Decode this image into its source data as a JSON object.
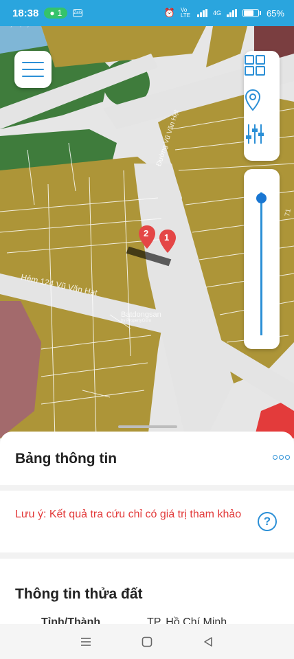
{
  "status_bar": {
    "time": "18:38",
    "hotspot_count": "1",
    "zalo_label": "Zalo",
    "volte_label": "Vo LTE",
    "network_label": "4G",
    "battery": "65%"
  },
  "map": {
    "watermark_brand": "Batdongsan",
    "watermark_sub": "by PropertyGuru",
    "street_1": "Đường Vũ Văn Hạt",
    "street_2": "Hẻm 124 Vũ Văn Hạt",
    "marker_1": "1",
    "marker_2": "2",
    "edge_label": "71",
    "zoom_level": 0.04
  },
  "sheet": {
    "title": "Bảng thông tin",
    "notice": "Lưu ý: Kết quả tra cứu chỉ có giá trị tham khảo",
    "help_symbol": "?",
    "parcel_title": "Thông tin thửa đất",
    "province_label": "Tỉnh/Thành",
    "province_value": "TP. Hồ Chí Minh"
  },
  "colors": {
    "status_bar": "#2aa5de",
    "accent": "#2b8fd6",
    "land_residential": "#ad9538",
    "land_green": "#3e7a3a",
    "notice_text": "#e23a3a"
  },
  "icons": [
    "menu-icon",
    "grid-icon",
    "location-pin-icon",
    "filter-sliders-icon",
    "more-icon",
    "help-icon",
    "nav-recents-icon",
    "nav-home-icon",
    "nav-back-icon"
  ]
}
